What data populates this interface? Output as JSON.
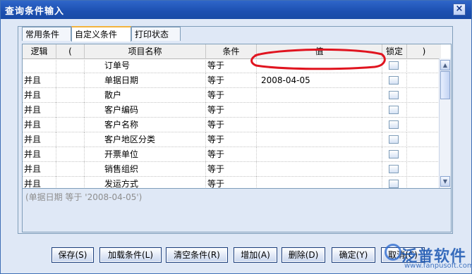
{
  "window": {
    "title": "查询条件输入",
    "close_glyph": "×"
  },
  "tabs": [
    {
      "label": "常用条件",
      "active": false
    },
    {
      "label": "自定义条件",
      "active": true
    },
    {
      "label": "打印状态",
      "active": false
    }
  ],
  "grid": {
    "columns": [
      "逻辑",
      "(",
      "项目名称",
      "条件",
      "值",
      "锁定",
      ")"
    ],
    "rows": [
      {
        "logic": "",
        "paren_open": "",
        "name": "订单号",
        "cond": "等于",
        "value": "",
        "paren_close": ""
      },
      {
        "logic": "并且",
        "paren_open": "",
        "name": "单据日期",
        "cond": "等于",
        "value": "2008-04-05",
        "paren_close": ""
      },
      {
        "logic": "并且",
        "paren_open": "",
        "name": "散户",
        "cond": "等于",
        "value": "",
        "paren_close": ""
      },
      {
        "logic": "并且",
        "paren_open": "",
        "name": "客户编码",
        "cond": "等于",
        "value": "",
        "paren_close": ""
      },
      {
        "logic": "并且",
        "paren_open": "",
        "name": "客户名称",
        "cond": "等于",
        "value": "",
        "paren_close": ""
      },
      {
        "logic": "并且",
        "paren_open": "",
        "name": "客户地区分类",
        "cond": "等于",
        "value": "",
        "paren_close": ""
      },
      {
        "logic": "并且",
        "paren_open": "",
        "name": "开票单位",
        "cond": "等于",
        "value": "",
        "paren_close": ""
      },
      {
        "logic": "并且",
        "paren_open": "",
        "name": "销售组织",
        "cond": "等于",
        "value": "",
        "paren_close": ""
      },
      {
        "logic": "并且",
        "paren_open": "",
        "name": "发运方式",
        "cond": "等于",
        "value": "",
        "paren_close": ""
      }
    ]
  },
  "expression": "(单据日期 等于 '2008-04-05')",
  "buttons": {
    "save": "保存(S)",
    "load": "加载条件(L)",
    "clear": "清空条件(R)",
    "add": "增加(A)",
    "delete": "删除(D)",
    "ok": "确定(Y)",
    "cancel": "取消(C)"
  },
  "watermark": {
    "name": "泛普软件",
    "url": "www.fanpusoft.com"
  },
  "colors": {
    "title_bar": "#1c4fb0",
    "panel": "#dfe8f6",
    "annotation": "#e0141f",
    "watermark": "#1a57b3"
  }
}
